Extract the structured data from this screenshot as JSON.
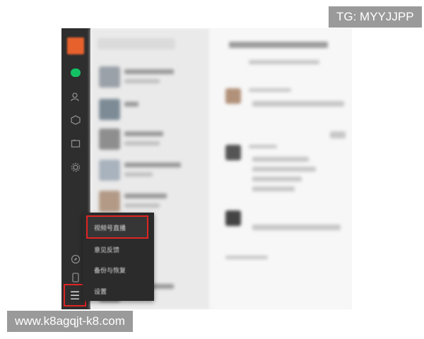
{
  "watermarks": {
    "top_right": "TG: MYYJJPP",
    "bottom_left": "www.k8agqjt-k8.com"
  },
  "sidebar": {
    "icons": [
      "chat-icon",
      "contacts-icon",
      "favorites-icon",
      "files-icon",
      "settings-gear-icon",
      "moments-icon",
      "phone-icon",
      "menu-icon"
    ],
    "menu_glyph": "☰",
    "accent_color": "#13c265"
  },
  "menu_popup": {
    "items": [
      {
        "label": "视频号直播"
      },
      {
        "label": "意见反馈"
      },
      {
        "label": "备份与恢复"
      },
      {
        "label": "设置"
      }
    ],
    "highlight_color": "#e02424"
  }
}
